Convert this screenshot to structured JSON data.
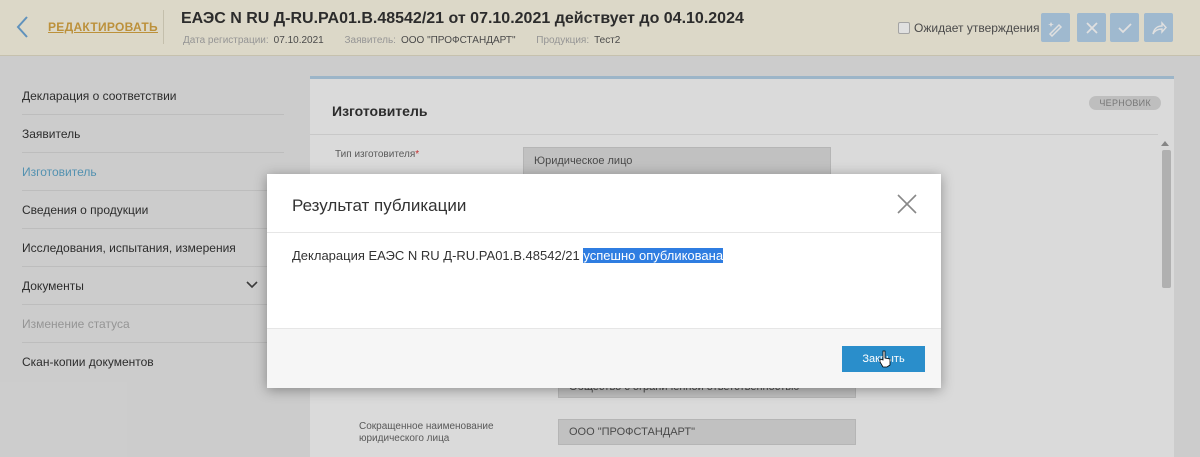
{
  "header": {
    "back_label": "РЕДАКТИРОВАТЬ",
    "title": "ЕАЭС N RU Д-RU.PA01.B.48542/21 от 07.10.2021 действует до 04.10.2024",
    "meta": {
      "reg_date_label": "Дата регистрации:",
      "reg_date": "07.10.2021",
      "applicant_label": "Заявитель:",
      "applicant": "ООО \"ПРОФСТАНДАРТ\"",
      "product_label": "Продукция:",
      "product": "Тест2"
    },
    "await_label": "Ожидает утверждения",
    "toolbar_icons": [
      "sign-icon",
      "close-icon",
      "check-icon",
      "share-icon"
    ],
    "accent": "#d6a544"
  },
  "sidebar": {
    "items": [
      {
        "label": "Декларация о соответствии",
        "state": "normal"
      },
      {
        "label": "Заявитель",
        "state": "normal"
      },
      {
        "label": "Изготовитель",
        "state": "active"
      },
      {
        "label": "Сведения о продукции",
        "state": "normal"
      },
      {
        "label": "Исследования, испытания, измерения",
        "state": "normal"
      },
      {
        "label": "Документы",
        "state": "normal"
      },
      {
        "label": "Изменение статуса",
        "state": "disabled"
      },
      {
        "label": "Скан-копии документов",
        "state": "normal"
      }
    ],
    "active_color": "#5fa6c9"
  },
  "main": {
    "title": "Изготовитель",
    "badge": "ЧЕРНОВИК",
    "fields": {
      "manufacturer_type_label": "Тип изготовителя",
      "manufacturer_type_value": "Юридическое лицо",
      "partial_value": "Общество с ограниченной ответственностью",
      "short_name_label": "Сокращенное наименование юридического лица",
      "short_name_value": "ООО \"ПРОФСТАНДАРТ\""
    }
  },
  "modal": {
    "title": "Результат публикации",
    "message_prefix": "Декларация ЕАЭС N RU Д-RU.PA01.B.48542/21 ",
    "message_highlight": "успешно опубликована",
    "close_button": "Закрыть",
    "button_color": "#2a8ecb",
    "highlight_color": "#2f7de1"
  }
}
